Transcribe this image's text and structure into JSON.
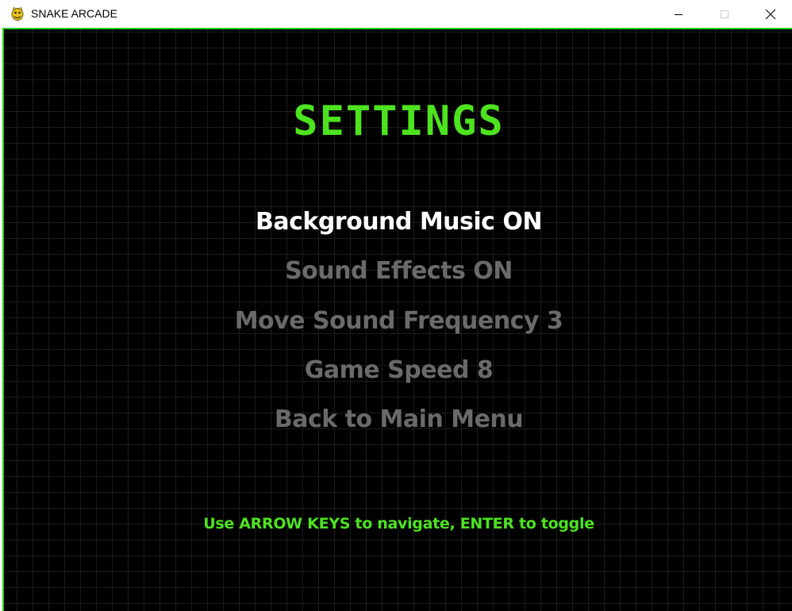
{
  "window": {
    "title": "SNAKE ARCADE",
    "icon": "pygame-snake-icon"
  },
  "screen": {
    "heading": "SETTINGS",
    "menu_items": [
      {
        "label": "Background Music ON",
        "selected": true
      },
      {
        "label": "Sound Effects ON",
        "selected": false
      },
      {
        "label": "Move Sound Frequency 3",
        "selected": false
      },
      {
        "label": "Game Speed 8",
        "selected": false
      },
      {
        "label": "Back to Main Menu",
        "selected": false
      }
    ],
    "hint": "Use ARROW KEYS to navigate, ENTER to toggle"
  },
  "colors": {
    "accent_green": "#4de31f",
    "selected_item": "#ffffff",
    "unselected_item": "#6a6a6a",
    "background": "#000000",
    "grid_line": "#1c1c1c"
  }
}
